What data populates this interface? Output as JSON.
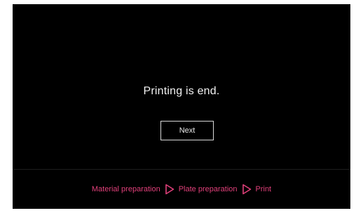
{
  "message": "Printing is end.",
  "next_button": "Next",
  "steps": [
    {
      "label": "Material preparation"
    },
    {
      "label": "Plate preparation"
    },
    {
      "label": "Print"
    }
  ],
  "colors": {
    "background": "#000000",
    "accent": "#e0407a",
    "text": "#f2f2f2"
  },
  "icons": {
    "step_separator": "play-triangle-outline-icon"
  }
}
